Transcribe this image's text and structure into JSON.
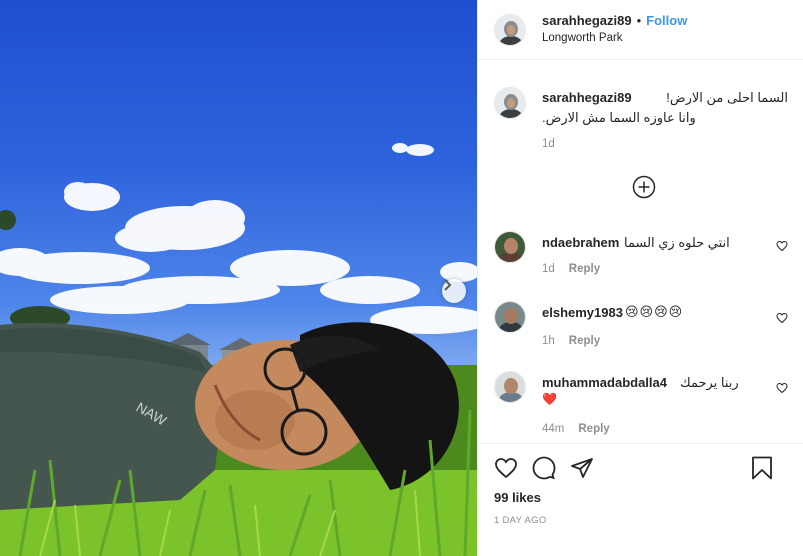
{
  "post": {
    "author": "sarahhegazi89",
    "separator": "•",
    "follow_label": "Follow",
    "location": "Longworth Park"
  },
  "caption": {
    "username": "sarahhegazi89",
    "line1": "السما احلى من الارض!",
    "line2": "وانا عاوزه السما مش الارض.",
    "time": "1d"
  },
  "comments": [
    {
      "username": "ndaebrahem",
      "text": "انتي حلوه زي السما",
      "time": "1d",
      "reply_label": "Reply"
    },
    {
      "username": "elshemy1983",
      "text": "😢😢😢😢",
      "time": "1h",
      "reply_label": "Reply"
    },
    {
      "username": "muhammadabdalla4",
      "text": "ربنا يرحمك",
      "extra": "❤️",
      "time": "44m",
      "reply_label": "Reply"
    }
  ],
  "actions": {
    "likes": "99 likes",
    "time_ago": "1 DAY AGO"
  },
  "icons": {
    "like": "heart-icon",
    "comment": "comment-icon",
    "share": "share-icon",
    "save": "bookmark-icon",
    "load_more": "plus-circle-icon",
    "next": "chevron-right-icon"
  },
  "colors": {
    "link": "#3897f0",
    "meta": "#8e8e8e",
    "heart_red": "#ed4956"
  }
}
